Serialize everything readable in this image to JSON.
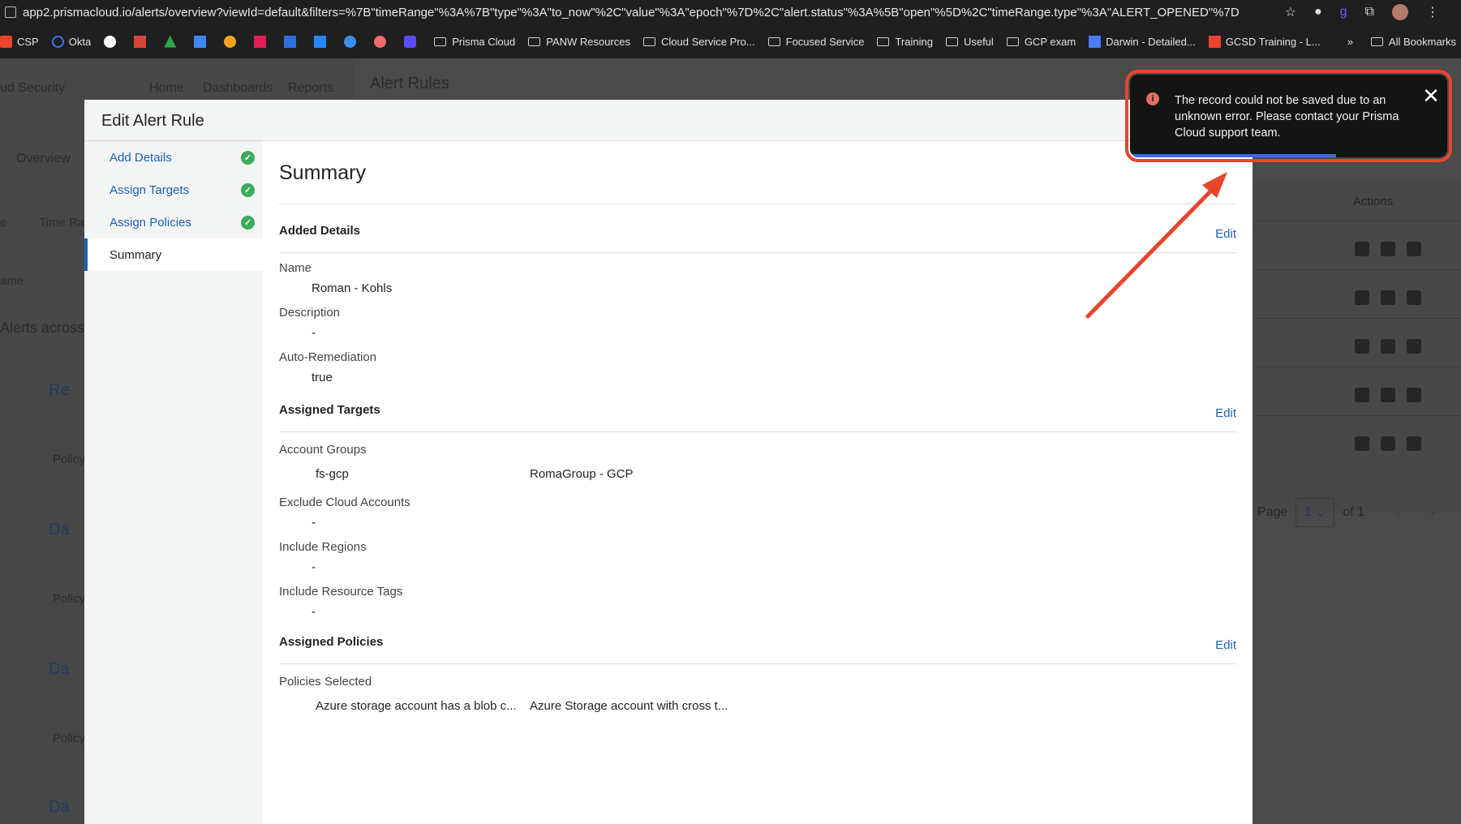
{
  "browser": {
    "url": "app2.prismacloud.io/alerts/overview?viewId=default&filters=%7B\"timeRange\"%3A%7B\"type\"%3A\"to_now\"%2C\"value\"%3A\"epoch\"%7D%2C\"alert.status\"%3A%5B\"open\"%5D%2C\"timeRange.type\"%3A\"ALERT_OPENED\"%7D",
    "bookmarks": [
      "CSP",
      "Okta",
      "Prisma Cloud",
      "PANW Resources",
      "Cloud Service Pro...",
      "Focused Service",
      "Training",
      "Useful",
      "GCP exam",
      "Darwin - Detailed...",
      "GCSD Training - L..."
    ],
    "all_bookmarks": "All Bookmarks",
    "overflow": "»"
  },
  "app": {
    "brand": "ud Security",
    "nav": [
      "Home",
      "Dashboards",
      "Reports"
    ],
    "page_title": "Alert Rules",
    "bg_overview": "Overview",
    "bg_time_range": "Time Ra",
    "bg_col_left": "e",
    "bg_name_sort": "ame",
    "bg_alerts_across": "Alerts across",
    "bg_rules": [
      "Re",
      "Da",
      "Da",
      "Da"
    ],
    "bg_policy": "Policy",
    "actions_header": "Actions",
    "pager": {
      "page_label": "Page",
      "page_value": "1",
      "of_label": "of 1"
    }
  },
  "modal": {
    "title": "Edit Alert Rule",
    "steps": [
      {
        "label": "Add Details",
        "done": true
      },
      {
        "label": "Assign Targets",
        "done": true
      },
      {
        "label": "Assign Policies",
        "done": true
      },
      {
        "label": "Summary",
        "done": false
      }
    ],
    "summary_title": "Summary",
    "edit_label": "Edit",
    "added_details": {
      "title": "Added Details",
      "name_label": "Name",
      "name_value": "Roman - Kohls",
      "description_label": "Description",
      "description_value": "-",
      "auto_remediation_label": "Auto-Remediation",
      "auto_remediation_value": "true"
    },
    "assigned_targets": {
      "title": "Assigned Targets",
      "account_groups_label": "Account Groups",
      "account_groups": [
        "fs-gcp",
        "RomaGroup - GCP"
      ],
      "exclude_label": "Exclude Cloud Accounts",
      "exclude_value": "-",
      "regions_label": "Include Regions",
      "regions_value": "-",
      "tags_label": "Include Resource Tags",
      "tags_value": "-"
    },
    "assigned_policies": {
      "title": "Assigned Policies",
      "selected_label": "Policies Selected",
      "policies": [
        "Azure storage account has a blob c...",
        "Azure Storage account with cross t..."
      ]
    }
  },
  "toast": {
    "message": "The record could not be saved due to an unknown error. Please contact your Prisma Cloud support team.",
    "close": "✕",
    "progress": 0.65,
    "severity": "error"
  },
  "annotation": {
    "color": "#e8452c"
  }
}
